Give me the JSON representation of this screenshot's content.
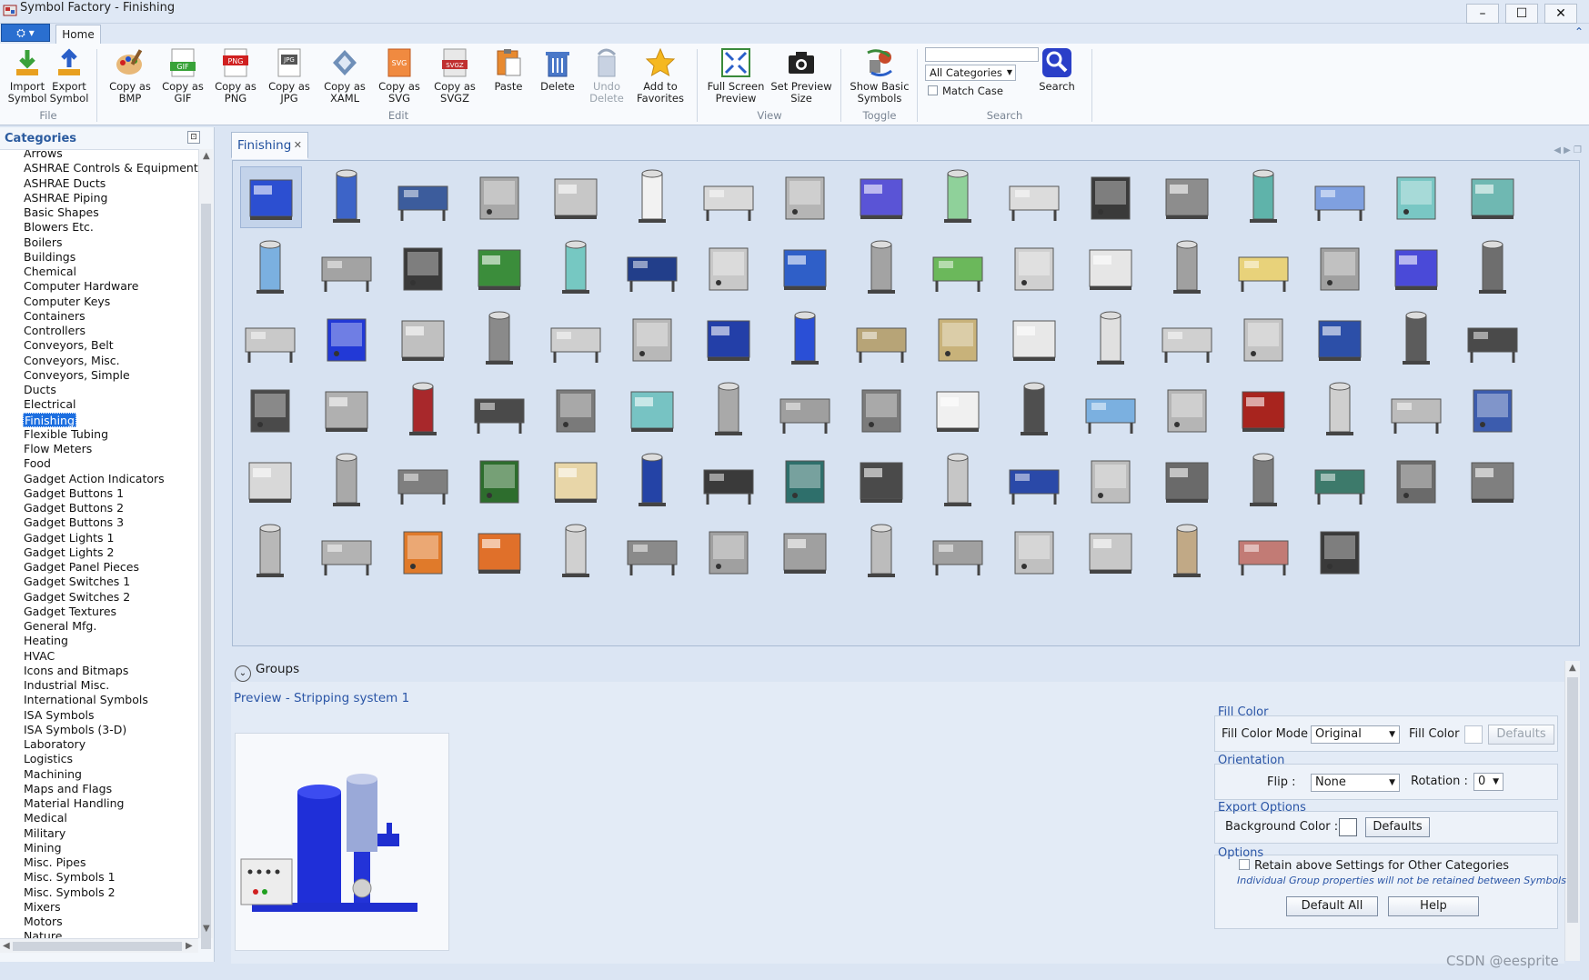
{
  "window": {
    "title": "Symbol Factory - Finishing",
    "minimize": "–",
    "maximize": "☐",
    "close": "✕"
  },
  "ribbon": {
    "app_menu": "▾",
    "tab_home": "Home",
    "collapse": "⌃",
    "buttons": {
      "import_symbol": "Import Symbol",
      "export_symbol": "Export Symbol",
      "copy_bmp": "Copy as BMP",
      "copy_gif": "Copy as GIF",
      "copy_png": "Copy as PNG",
      "copy_jpg": "Copy as JPG",
      "copy_xaml": "Copy as XAML",
      "copy_svg": "Copy as SVG",
      "copy_svgz": "Copy as SVGZ",
      "paste": "Paste",
      "delete": "Delete",
      "undo_delete": "Undo Delete",
      "add_favorites": "Add to Favorites",
      "full_screen": "Full Screen Preview",
      "set_preview": "Set Preview Size",
      "show_basic": "Show Basic Symbols",
      "search": "Search"
    },
    "groups": {
      "file": "File",
      "edit": "Edit",
      "view": "View",
      "toggle": "Toggle",
      "search": "Search"
    },
    "search_value": "",
    "category_select": "All Categories",
    "match_case": "Match Case"
  },
  "categories": {
    "header": "Categories",
    "pin": "📌",
    "items": [
      "Arrows",
      "ASHRAE Controls & Equipment",
      "ASHRAE Ducts",
      "ASHRAE Piping",
      "Basic Shapes",
      "Blowers Etc.",
      "Boilers",
      "Buildings",
      "Chemical",
      "Computer Hardware",
      "Computer Keys",
      "Containers",
      "Controllers",
      "Conveyors, Belt",
      "Conveyors, Misc.",
      "Conveyors, Simple",
      "Ducts",
      "Electrical",
      "Finishing",
      "Flexible Tubing",
      "Flow Meters",
      "Food",
      "Gadget Action Indicators",
      "Gadget Buttons 1",
      "Gadget Buttons 2",
      "Gadget Buttons 3",
      "Gadget Lights 1",
      "Gadget Lights 2",
      "Gadget Panel Pieces",
      "Gadget Switches 1",
      "Gadget Switches 2",
      "Gadget Textures",
      "General Mfg.",
      "Heating",
      "HVAC",
      "Icons and Bitmaps",
      "Industrial Misc.",
      "International Symbols",
      "ISA Symbols",
      "ISA Symbols (3-D)",
      "Laboratory",
      "Logistics",
      "Machining",
      "Maps and Flags",
      "Material Handling",
      "Medical",
      "Military",
      "Mining",
      "Misc. Pipes",
      "Misc. Symbols 1",
      "Misc. Symbols 2",
      "Mixers",
      "Motors",
      "Nature"
    ],
    "selected_index": 18
  },
  "document_tab": {
    "label": "Finishing",
    "close": "✕"
  },
  "symbols": {
    "selected_index": 0,
    "colors": [
      "#2c4fd1",
      "#3d64c8",
      "#3c5c9c",
      "#a8a8a8",
      "#c7c7c7",
      "#f2f2f2",
      "#d9d9d9",
      "#b5b5b5",
      "#5a54d6",
      "#8fd19a",
      "#dcdcdc",
      "#3a3a3a",
      "#8d8d8d",
      "#5fb3aa",
      "#7fa0e0",
      "#79c7c4",
      "#6fb8b2",
      "#7bb0e0",
      "#a3a3a3",
      "#3a3a3a",
      "#3b8d3b",
      "#76c8c2",
      "#223e8a",
      "#c8c8c8",
      "#2f5fc8",
      "#a3a3a3",
      "#6bb85b",
      "#d0d0d0",
      "#e6e6e6",
      "#a0a0a0",
      "#e8d27a",
      "#a0a0a0",
      "#4a4ad8",
      "#6e6e6e",
      "#c9c9c9",
      "#2239d6",
      "#c0c0c0",
      "#8a8a8a",
      "#cfcfcf",
      "#b8b8b8",
      "#233fa8",
      "#2a4fd6",
      "#b7a477",
      "#c8b27a",
      "#e8e8e8",
      "#e0e0e0",
      "#d0d0d0",
      "#c4c4c4",
      "#2c4fa8",
      "#5c5c5c",
      "#4a4a4a",
      "#4a4a4a",
      "#b0b0b0",
      "#a8282b",
      "#4a4a4a",
      "#7a7a7a",
      "#77c3c3",
      "#a9a9a9",
      "#9f9f9f",
      "#7b7b7b",
      "#f0f0f0",
      "#4f4f4f",
      "#7bb0e0",
      "#b5b5b5",
      "#a8241e",
      "#cfcfcf",
      "#bcbcbc",
      "#3c5cae",
      "#d8d8d8",
      "#a9a9a9",
      "#7f7f7f",
      "#2d6d2d",
      "#e8d6a8",
      "#2443a6",
      "#3a3a3a",
      "#2e6f6b",
      "#4a4a4a",
      "#c6c6c6",
      "#2a49a8",
      "#bdbdbd",
      "#6a6a6a",
      "#7a7a7a",
      "#3d7a6b",
      "#6a6a6a",
      "#7f7f7f",
      "#b8b8b8",
      "#b3b3b3",
      "#e07a2a",
      "#e0702a",
      "#d0d0d0",
      "#8a8a8a",
      "#a0a0a0",
      "#a0a0a0",
      "#bcbcbc",
      "#a0a0a0",
      "#c0c0c0",
      "#c8c8c8",
      "#c1a986",
      "#c27b75",
      "#3a3a3a"
    ]
  },
  "lower": {
    "groups_label": "Groups",
    "groups_chevron": "⌄",
    "preview_title": "Preview - Stripping system 1"
  },
  "properties": {
    "fill_color_title": "Fill Color",
    "fill_mode_label": "Fill Color Mode",
    "fill_mode_value": "Original",
    "fill_color_label": "Fill Color",
    "fill_defaults": "Defaults",
    "orientation_title": "Orientation",
    "flip_label": "Flip :",
    "flip_value": "None",
    "rotation_label": "Rotation :",
    "rotation_value": "0",
    "export_title": "Export Options",
    "bg_color_label": "Background Color :",
    "export_defaults": "Defaults",
    "options_title": "Options",
    "retain_label": "Retain above Settings for Other Categories",
    "retain_hint": "Individual Group properties will not be retained between Symbols",
    "default_all": "Default All",
    "help": "Help"
  },
  "watermark": "CSDN @eesprite"
}
